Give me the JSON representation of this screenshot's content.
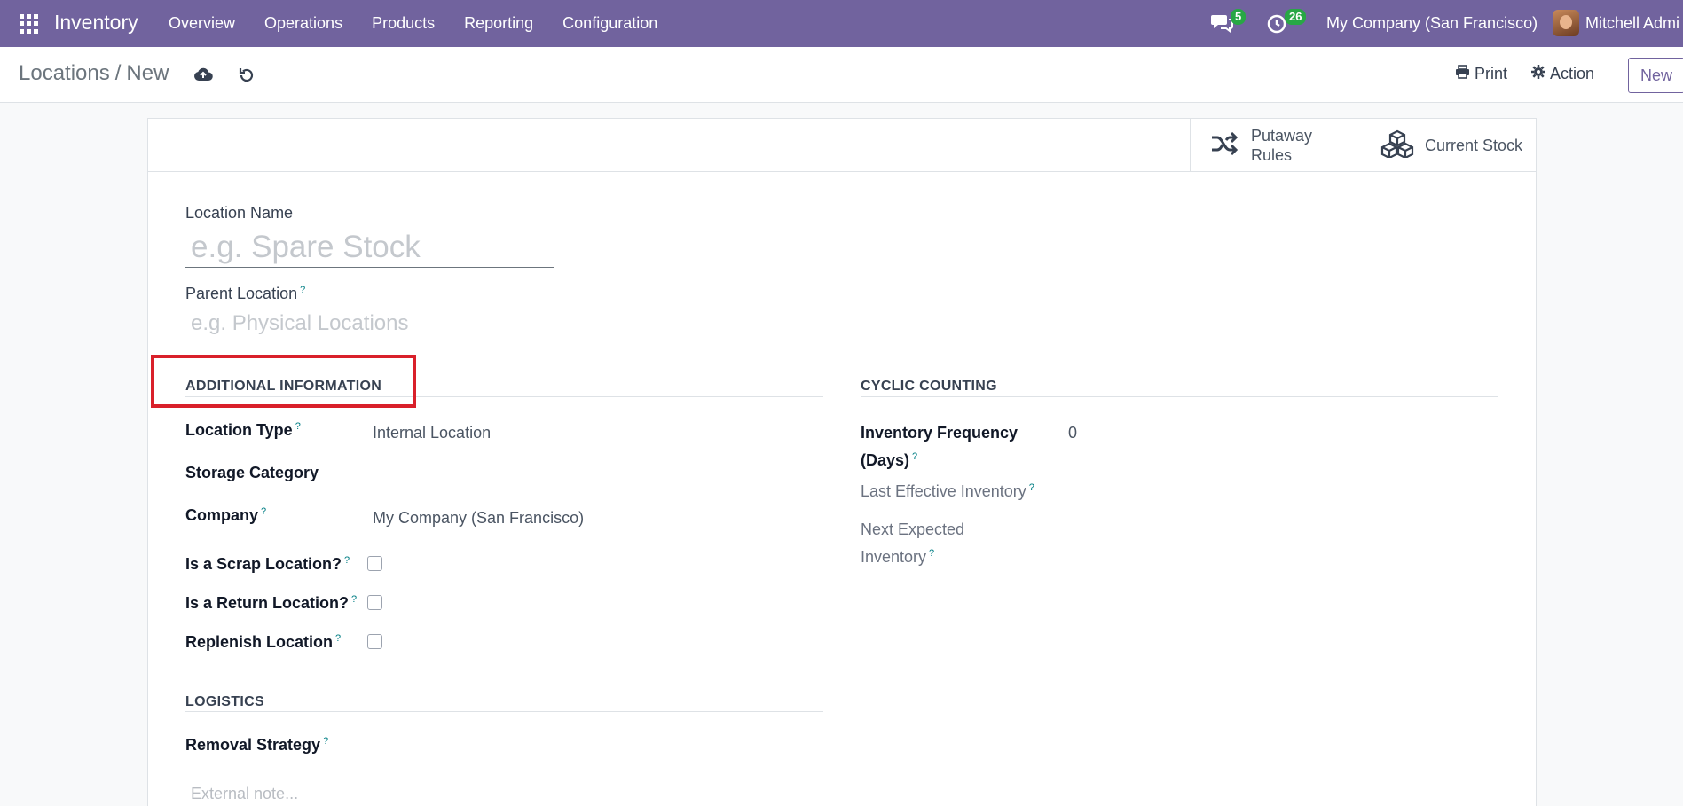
{
  "navbar": {
    "brand": "Inventory",
    "menu": [
      "Overview",
      "Operations",
      "Products",
      "Reporting",
      "Configuration"
    ],
    "messages_count": "5",
    "activities_count": "26",
    "company": "My Company (San Francisco)",
    "user": "Mitchell Admi"
  },
  "control": {
    "breadcrumb_parent": "Locations",
    "breadcrumb_sep": "/",
    "breadcrumb_current": "New",
    "print_label": "Print",
    "action_label": "Action",
    "new_label": "New"
  },
  "smart_buttons": {
    "putaway_line1": "Putaway",
    "putaway_line2": "Rules",
    "current_stock": "Current Stock"
  },
  "form": {
    "location_name_label": "Location Name",
    "location_name_placeholder": "e.g. Spare Stock",
    "parent_location_label": "Parent Location",
    "parent_location_placeholder": "e.g. Physical Locations",
    "help_mark": "?",
    "additional_info": {
      "title": "ADDITIONAL INFORMATION",
      "location_type_label": "Location Type",
      "location_type_value": "Internal Location",
      "storage_category_label": "Storage Category",
      "company_label": "Company",
      "company_value": "My Company (San Francisco)",
      "scrap_label": "Is a Scrap Location?",
      "return_label": "Is a Return Location?",
      "replenish_label": "Replenish Location"
    },
    "cyclic": {
      "title": "CYCLIC COUNTING",
      "frequency_label_1": "Inventory Frequency",
      "frequency_label_2": "(Days)",
      "frequency_value": "0",
      "last_effective_label": "Last Effective Inventory",
      "next_expected_label_1": "Next Expected",
      "next_expected_label_2": "Inventory"
    },
    "logistics": {
      "title": "LOGISTICS",
      "removal_label": "Removal Strategy"
    },
    "external_note_placeholder": "External note..."
  }
}
